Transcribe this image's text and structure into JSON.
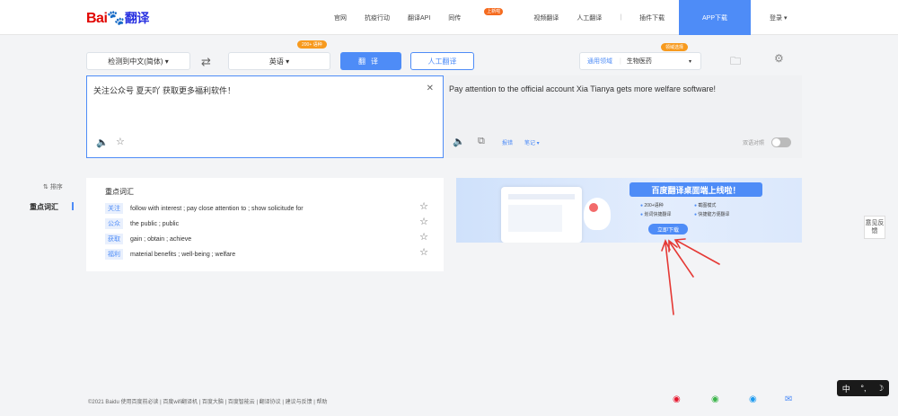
{
  "header": {
    "logo_text_a": "Bai",
    "logo_paw": "🐾",
    "logo_text_b": "翻译",
    "nav": [
      "官网",
      "抗疫行动",
      "翻译API",
      "同传",
      "视频翻译",
      "人工翻译",
      "插件下载"
    ],
    "nav_badge": "上新啦",
    "app_button": "APP下载",
    "login": "登录 ▾"
  },
  "controls": {
    "source_lang": "检测到中文(简体) ▾",
    "swap_icon": "⇄",
    "target_lang": "英语 ▾",
    "target_badge": "200+ 语种",
    "translate_btn": "翻译",
    "human_btn": "人工翻译",
    "domain_label": "通用领域",
    "domain_value": "生物医药",
    "domain_caret": "▾",
    "domain_badge": "领域选择",
    "doc_icon": "🗀",
    "settings_icon": "⚙"
  },
  "source": {
    "text": "关注公众号 夏天吖  获取更多福利软件！",
    "clear": "✕",
    "speaker": "🔈",
    "star": "☆"
  },
  "target": {
    "text": "Pay attention to the official account Xia Tianya gets more welfare software!",
    "speaker": "🔈",
    "copy": "⧉",
    "report": "报错",
    "notes": "笔记 ▾",
    "bilingual": "双语对照"
  },
  "sidebar": {
    "sort": "⇅ 排序",
    "keywords": "重点词汇"
  },
  "keywords": {
    "title": "重点词汇",
    "items": [
      {
        "word": "关注",
        "def": "follow with interest ; pay close attention to ; show solicitude for"
      },
      {
        "word": "公众",
        "def": "the public ; public"
      },
      {
        "word": "获取",
        "def": "gain ; obtain ; achieve"
      },
      {
        "word": "福利",
        "def": "material benefits ; well-being ; welfare"
      }
    ],
    "star": "☆"
  },
  "banner": {
    "title": "百度翻译桌面端上线啦！",
    "features": [
      "200+语种",
      "截图模式",
      "划词快捷翻译",
      "快捷键方便翻译"
    ],
    "download": "立即下载"
  },
  "feedback": "意见反馈",
  "footer": {
    "text": "©2021 Baidu  使用百度前必读  |  百度wifi翻译机  |  百度大脑  |  百度智能云  |  翻译协议  |  建议与反馈  |  帮助"
  },
  "footer_icons": [
    "weibo-icon",
    "wechat-icon",
    "qq-icon",
    "mail-icon"
  ],
  "ime": {
    "lang": "中",
    "punct": "°,",
    "moon": "☽"
  },
  "colors": {
    "accent": "#4e8cf7",
    "arrow": "#e53935",
    "brand_red": "#e10602"
  }
}
